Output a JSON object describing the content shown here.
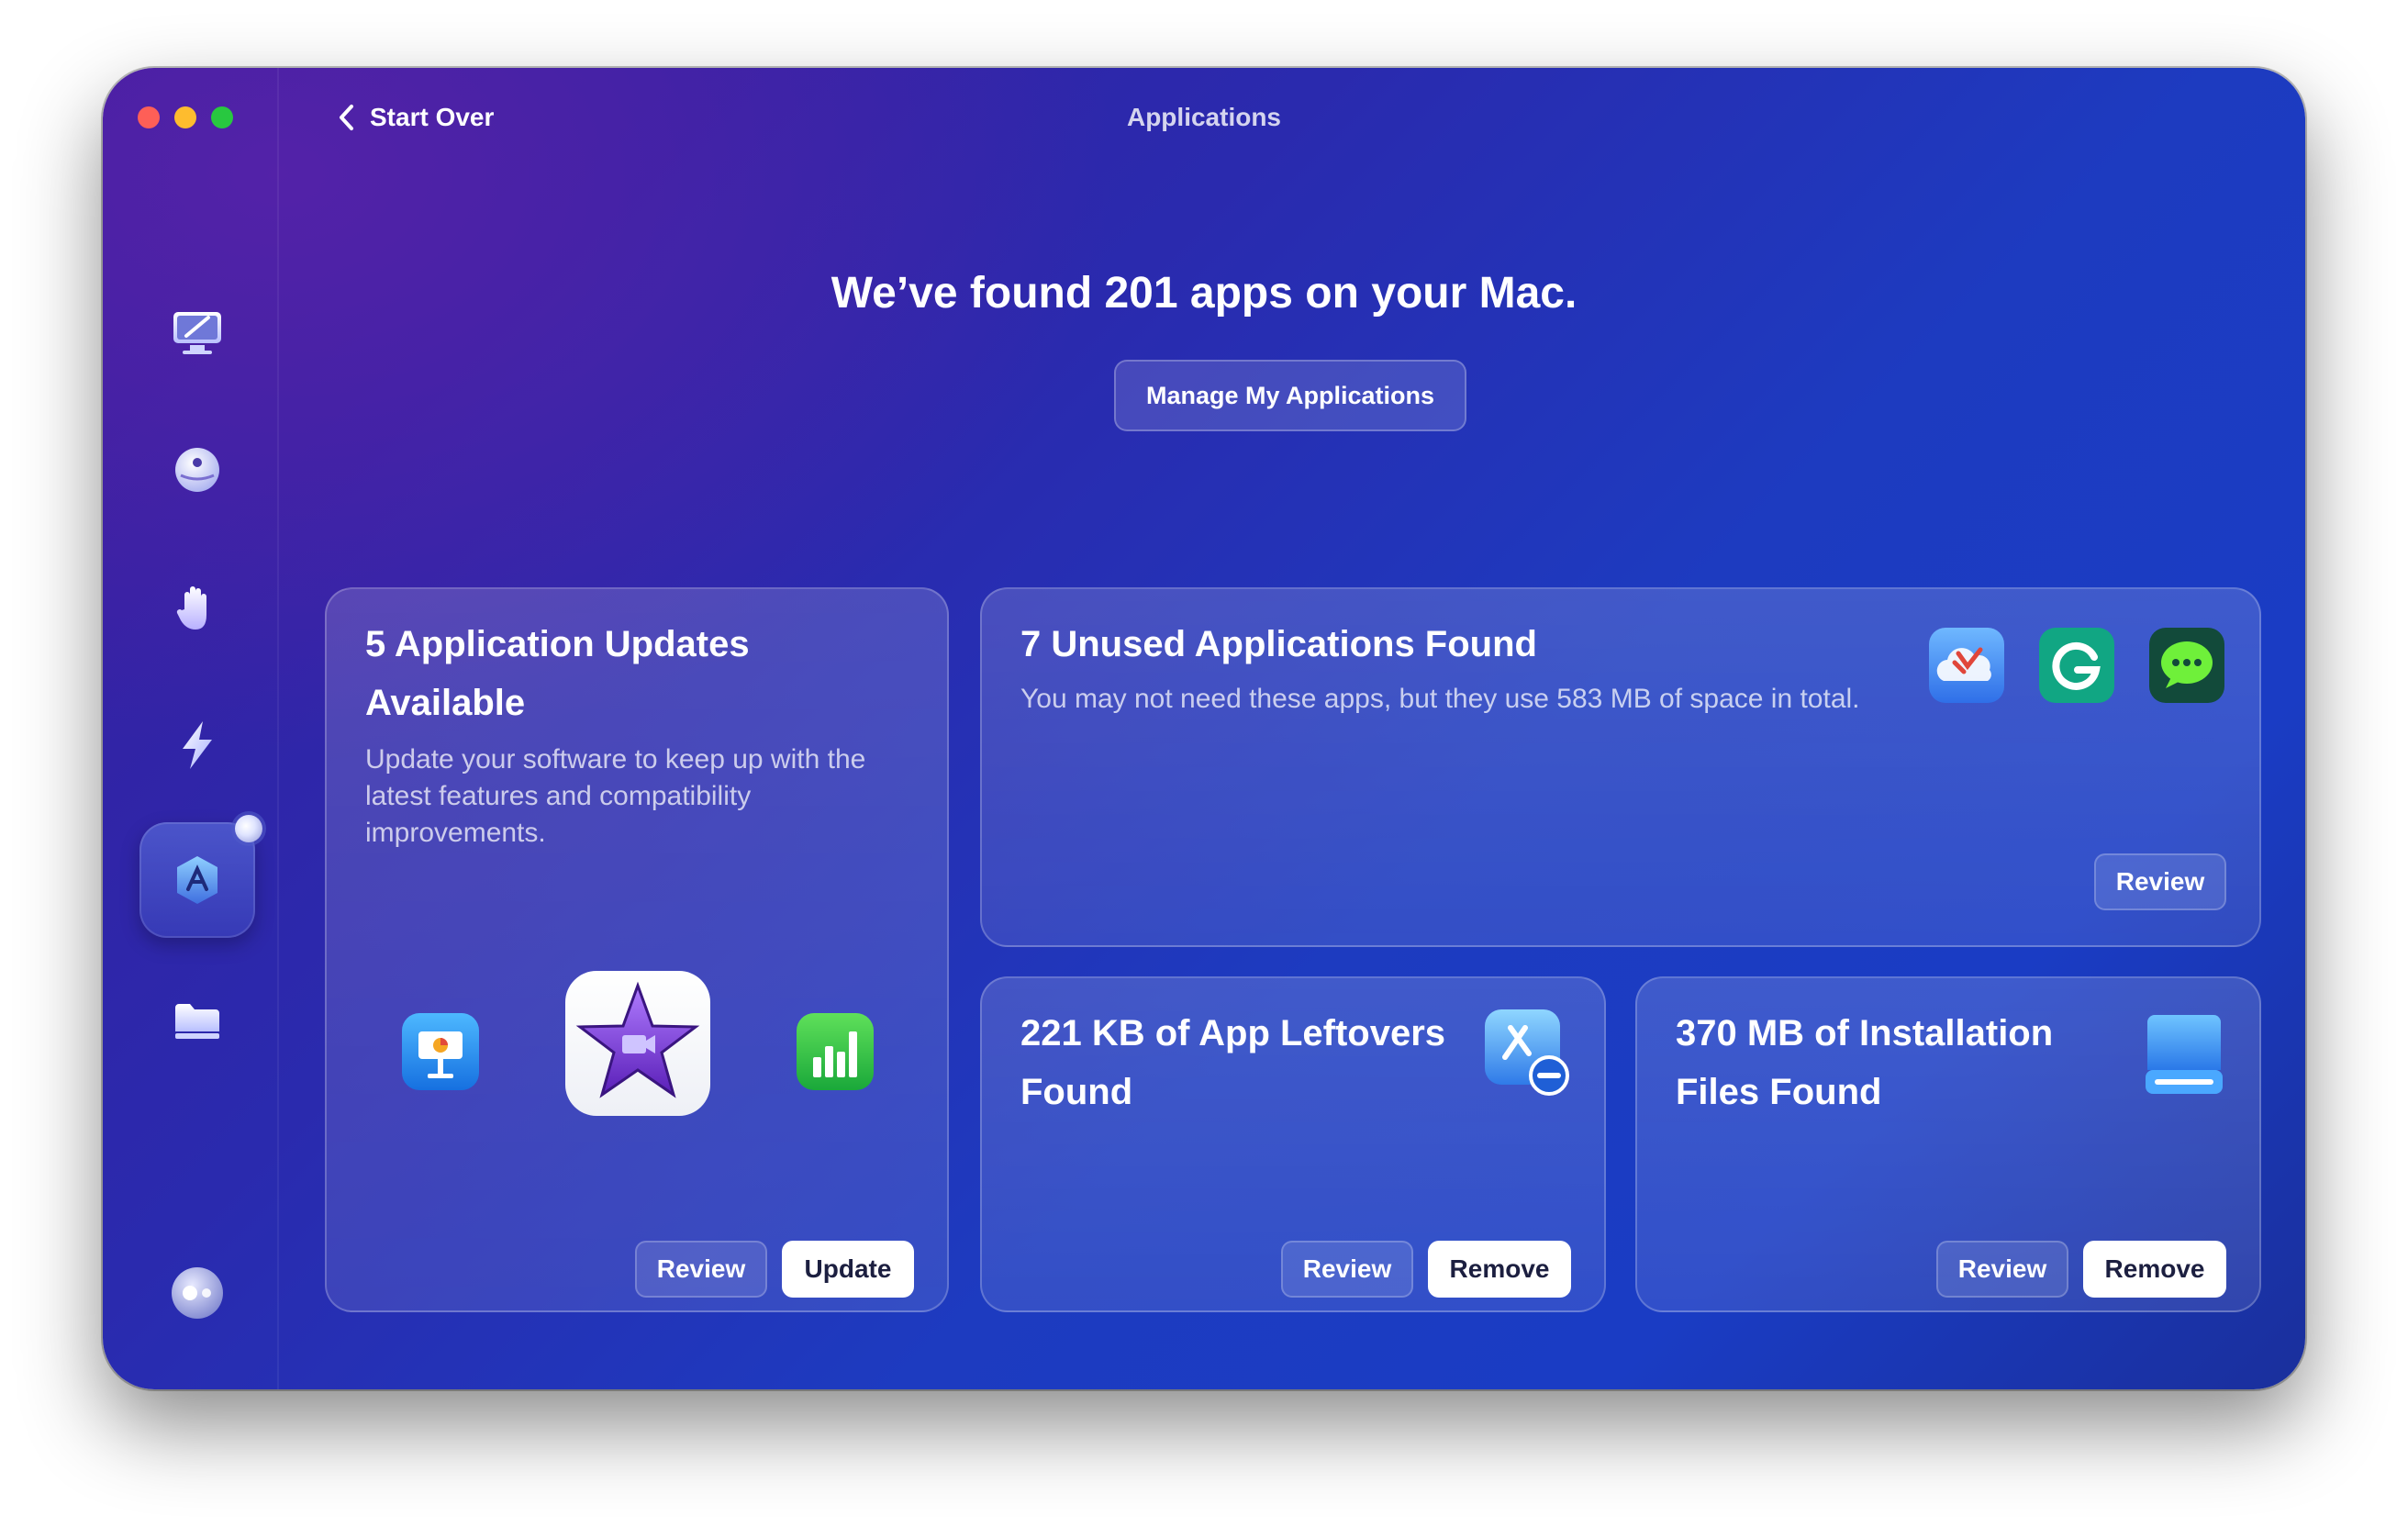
{
  "window": {
    "title": "Applications",
    "back_label": "Start Over"
  },
  "sidebar": {
    "items": [
      {
        "id": "cleanup",
        "icon": "monitor-cleanup-icon"
      },
      {
        "id": "protection",
        "icon": "protection-icon"
      },
      {
        "id": "privacy",
        "icon": "hand-icon"
      },
      {
        "id": "performance",
        "icon": "lightning-icon"
      },
      {
        "id": "applications",
        "icon": "applications-icon",
        "active": true
      },
      {
        "id": "files",
        "icon": "folder-icon"
      }
    ],
    "assistant_icon": "assistant-icon"
  },
  "main": {
    "headline": "We’ve found 201 apps on your Mac.",
    "manage_button": "Manage My Applications"
  },
  "cards": {
    "updates": {
      "title_line1": "5 Application Updates",
      "title_line2": "Available",
      "description": "Update your software to keep up with the latest features and compatibility improvements.",
      "review_label": "Review",
      "action_label": "Update",
      "icons": [
        "keynote-icon",
        "imovie-icon",
        "numbers-icon"
      ]
    },
    "unused": {
      "title": "7 Unused Applications Found",
      "description": "You may not need these apps, but they use 583 MB of space in total.",
      "review_label": "Review",
      "icons": [
        "cloud-app-icon",
        "grammarly-icon",
        "messages-app-icon"
      ]
    },
    "leftovers": {
      "title_line1": "221 KB of App Leftovers",
      "title_line2": "Found",
      "review_label": "Review",
      "action_label": "Remove",
      "icon": "app-leftovers-icon"
    },
    "installation": {
      "title_line1": "370 MB of Installation",
      "title_line2": "Files Found",
      "review_label": "Review",
      "action_label": "Remove",
      "icon": "installation-drive-icon"
    }
  },
  "colors": {
    "traffic_red": "#fe5f57",
    "traffic_yellow": "#febc2e",
    "traffic_green": "#28c840",
    "button_solid": "#ffffff"
  }
}
